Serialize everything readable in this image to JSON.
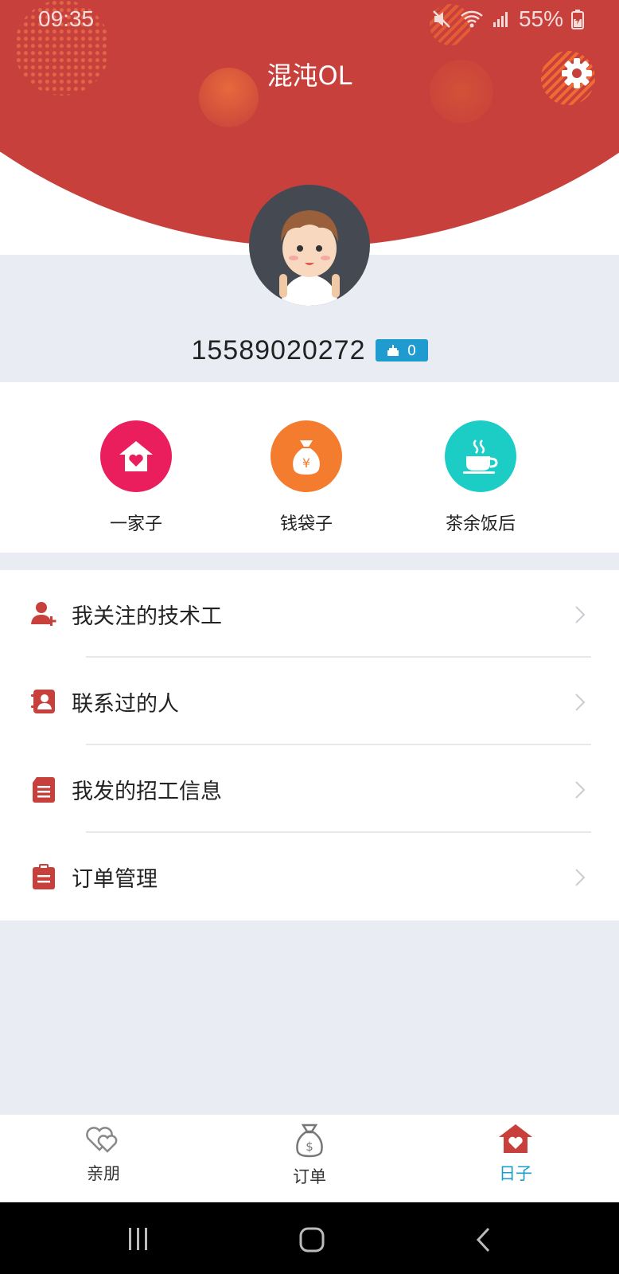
{
  "status_bar": {
    "time": "09:35",
    "battery": "55%"
  },
  "header": {
    "title": "混沌OL"
  },
  "profile": {
    "phone": "15589020272",
    "badge_count": "0"
  },
  "quick_links": [
    {
      "label": "一家子",
      "icon": "house-heart-icon",
      "color": "#ea1d5d"
    },
    {
      "label": "钱袋子",
      "icon": "money-bag-icon",
      "color": "#f47c2e"
    },
    {
      "label": "茶余饭后",
      "icon": "coffee-cup-icon",
      "color": "#1ccdc6"
    }
  ],
  "menu": [
    {
      "label": "我关注的技术工",
      "icon": "user-add-icon"
    },
    {
      "label": "联系过的人",
      "icon": "contact-card-icon"
    },
    {
      "label": "我发的招工信息",
      "icon": "document-icon"
    },
    {
      "label": "订单管理",
      "icon": "clipboard-icon"
    }
  ],
  "tabs": [
    {
      "label": "亲朋",
      "icon": "hearts-icon"
    },
    {
      "label": "订单",
      "icon": "money-bag-outline-icon"
    },
    {
      "label": "日子",
      "icon": "home-heart-icon",
      "active": true
    }
  ],
  "colors": {
    "brand_red": "#c7403c",
    "menu_icon": "#c7403c",
    "active_tab": "#1a9ccd",
    "badge": "#1f9bd0"
  }
}
